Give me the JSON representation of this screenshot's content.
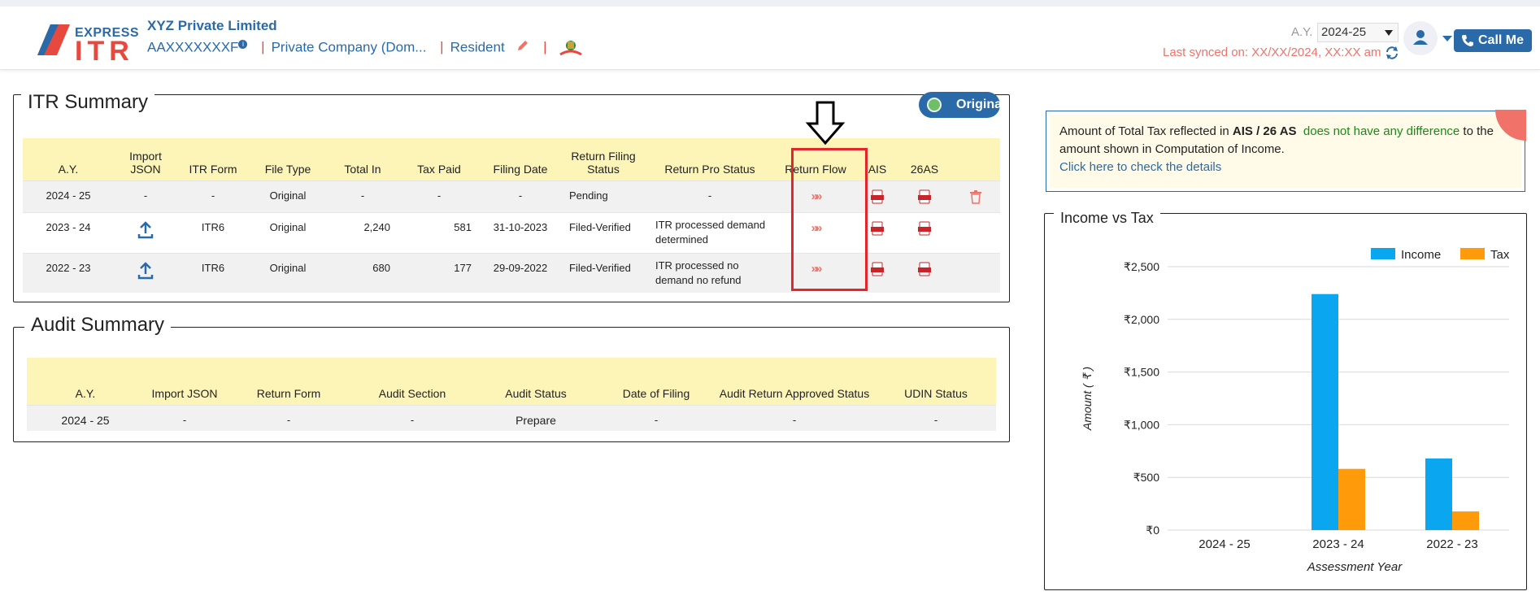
{
  "header": {
    "logo_express": "EXPRESS",
    "logo_itr": "ITR",
    "company_name": "XYZ Private Limited",
    "pan": "AAXXXXXXXF",
    "company_type": "Private Company (Dom...",
    "residency": "Resident",
    "ay_label": "A.Y.",
    "ay_value": "2024-25",
    "last_synced": "Last synced on: XX/XX/2024, XX:XX am",
    "call_me": "Call Me"
  },
  "itr_summary": {
    "title": "ITR Summary",
    "badge": "Original",
    "columns": [
      "A.Y.",
      "Import JSON",
      "ITR Form",
      "File Type",
      "Total In",
      "Tax Paid",
      "Filing Date",
      "Return Filing Status",
      "Return Pro Status",
      "Return Flow",
      "AIS",
      "26AS"
    ],
    "rows": [
      {
        "ay": "2024 - 25",
        "import_json": "-",
        "itr_form": "-",
        "file_type": "Original",
        "total_in": "-",
        "tax_paid": "-",
        "filing_date": "-",
        "filing_status": "Pending",
        "pro_status": "-"
      },
      {
        "ay": "2023 - 24",
        "import_json": "upload-icon",
        "itr_form": "ITR6",
        "file_type": "Original",
        "total_in": "2,240",
        "tax_paid": "581",
        "filing_date": "31-10-2023",
        "filing_status": "Filed-Verified",
        "pro_status": "ITR processed demand determined"
      },
      {
        "ay": "2022 - 23",
        "import_json": "upload-icon",
        "itr_form": "ITR6",
        "file_type": "Original",
        "total_in": "680",
        "tax_paid": "177",
        "filing_date": "29-09-2022",
        "filing_status": "Filed-Verified",
        "pro_status": "ITR processed no demand no refund"
      }
    ],
    "return_flow_glyph": "»»"
  },
  "audit_summary": {
    "title": "Audit Summary",
    "columns": [
      "A.Y.",
      "Import JSON",
      "Return Form",
      "Audit Section",
      "Audit Status",
      "Date of Filing",
      "Audit Return Approved Status",
      "UDIN Status"
    ],
    "rows": [
      {
        "ay": "2024 - 25",
        "import_json": "-",
        "return_form": "-",
        "audit_section": "-",
        "audit_status": "Prepare",
        "date_of_filing": "-",
        "approved_status": "-",
        "udin_status": "-"
      }
    ]
  },
  "notice": {
    "text1": "Amount of Total Tax reflected in ",
    "bold": "AIS / 26 AS",
    "green": "does not have any difference",
    "text2": " to the amount shown in Computation of Income.",
    "link": "Click here to check the details"
  },
  "chart_data": {
    "type": "bar",
    "title": "Income vs Tax",
    "xlabel": "Assessment Year",
    "ylabel": "Amount ( ₹ )",
    "categories": [
      "2024 - 25",
      "2023 - 24",
      "2022 - 23"
    ],
    "series": [
      {
        "name": "Income",
        "values": [
          0,
          2240,
          680
        ],
        "color": "#0aa6f0"
      },
      {
        "name": "Tax",
        "values": [
          0,
          581,
          177
        ],
        "color": "#ff9a0a"
      }
    ],
    "ylim": [
      0,
      2500
    ],
    "yticks": [
      "₹0",
      "₹500",
      "₹1,000",
      "₹1,500",
      "₹2,000",
      "₹2,500"
    ],
    "legend": "top-right",
    "grid": true
  }
}
